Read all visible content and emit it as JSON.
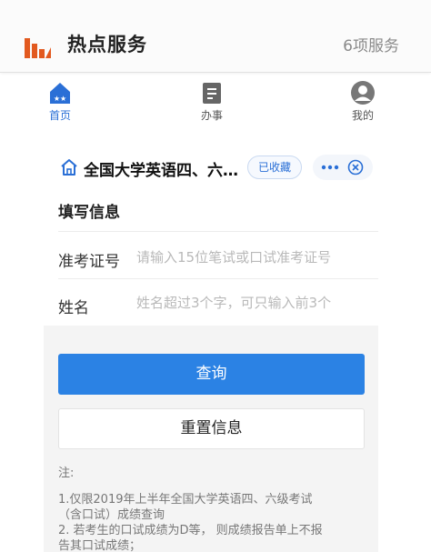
{
  "header": {
    "title": "热点服务",
    "count": "6项服务",
    "brand_color": "#e2591f"
  },
  "nav": {
    "items": [
      {
        "label": "首页",
        "icon": "home-star-icon",
        "active": true
      },
      {
        "label": "办事",
        "icon": "clipboard-icon",
        "active": false
      },
      {
        "label": "我的",
        "icon": "user-icon",
        "active": false
      }
    ],
    "active_color": "#2a6fd6"
  },
  "service": {
    "title": "全国大学英语四、六…",
    "favorite_label": "已收藏"
  },
  "form": {
    "section_title": "填写信息",
    "fields": [
      {
        "label": "准考证号",
        "placeholder": "请输入15位笔试或口试准考证号",
        "value": ""
      },
      {
        "label": "姓名",
        "placeholder": "姓名超过3个字，可只输入前3个",
        "value": ""
      }
    ],
    "query_label": "查询",
    "reset_label": "重置信息",
    "primary_color": "#2b82e4"
  },
  "notes": {
    "title": "注:",
    "lines": [
      "1.仅限2019年上半年全国大学英语四、六级考试",
      "（含口试）成绩查询",
      "2. 若考生的口试成绩为D等， 则成绩报告单上不报",
      "告其口试成绩；"
    ]
  }
}
